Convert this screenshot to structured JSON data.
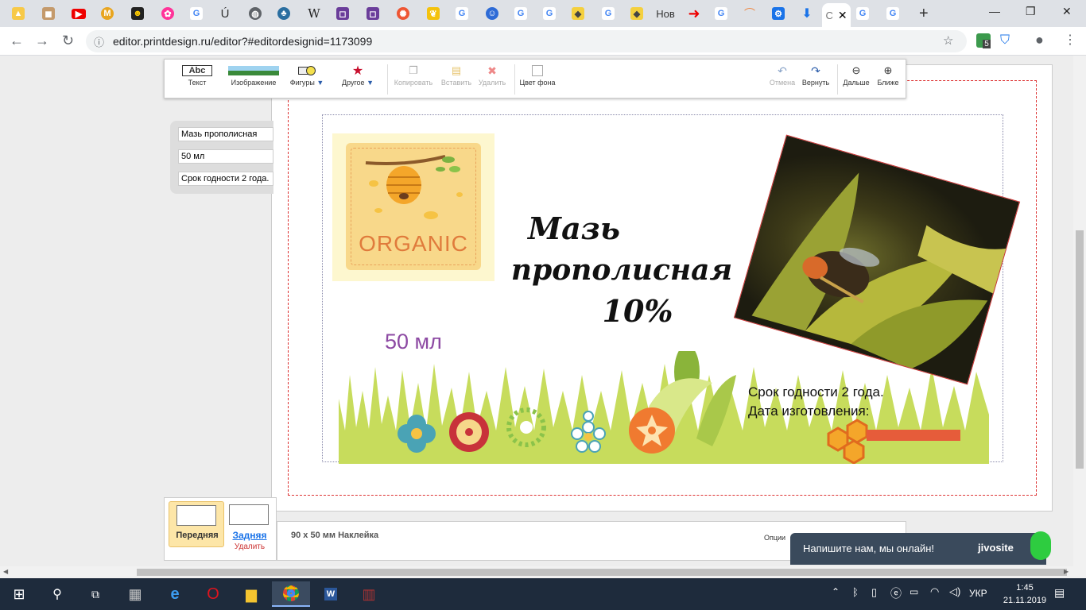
{
  "browser": {
    "url": "editor.printdesign.ru/editor?#editordesignid=1173099",
    "active_tab_label": "С",
    "tab_text_items": [
      "Ú",
      "W",
      "Нов"
    ],
    "extension_badge": "5"
  },
  "toolbar": {
    "text_label": "Текст",
    "text_icon": "Abc",
    "image_label": "Изображение",
    "shapes_label": "Фигуры",
    "other_label": "Другое",
    "copy_label": "Копировать",
    "paste_label": "Вставить",
    "delete_label": "Удалить",
    "bgcolor_label": "Цвет фона",
    "undo_label": "Отмена",
    "redo_label": "Вернуть",
    "farther_label": "Дальше",
    "closer_label": "Ближе"
  },
  "fields": [
    "Мазь прополисная",
    "50 мл",
    "Срок годности 2 года."
  ],
  "design": {
    "organic_label": "ORGANIC",
    "title_line1": "Мазь",
    "title_line2": "прополисная",
    "title_line3": "10%",
    "volume": "50 мл",
    "expiry_line1": "Срок годности 2 года.",
    "expiry_line2": "Дата изготовления:"
  },
  "product": {
    "size_label": "90 x 50 мм Наклейка",
    "options_label": "Опции"
  },
  "sides": {
    "front": "Передняя",
    "back": "Задняя",
    "delete": "Удалить"
  },
  "chat": {
    "message": "Напишите нам, мы онлайн!",
    "brand": "jivosite"
  },
  "taskbar": {
    "language": "УКР",
    "time": "1:45",
    "date": "21.11.2019"
  },
  "colors": {
    "title": "#111111",
    "volume": "#8d4aa3",
    "organic_text": "#e07b3c",
    "grass": "#c7dc5c",
    "bleed": "#dd3333",
    "chat": "#3a4a5c"
  }
}
